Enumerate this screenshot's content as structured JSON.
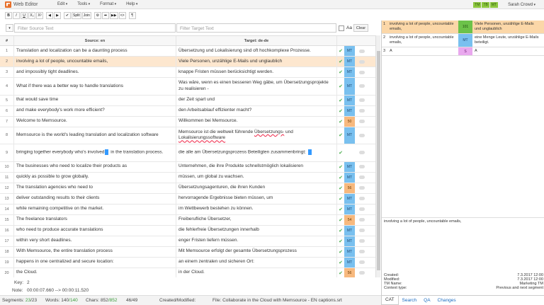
{
  "app": {
    "title": "Web Editor"
  },
  "menu": [
    "Edit",
    "Tools",
    "Format",
    "Help"
  ],
  "langs": [
    "TM",
    "TB",
    "MT"
  ],
  "user": "Sarah Crowd",
  "toolbar": {
    "bold": "B",
    "italic": "I",
    "underline": "U",
    "subscript": "X₂",
    "superscript": "X²",
    "undo": "◀",
    "redo": "▶",
    "confirm": "✔",
    "split": "Split",
    "join": "Join",
    "gear": "⚙",
    "next": "➡",
    "prev_next": "▶▶",
    "tags": "<>",
    "special": "¶"
  },
  "filter": {
    "source_placeholder": "Filter Source Text",
    "target_placeholder": "Filter Target Text",
    "case_label": "Aa",
    "clear": "Clear"
  },
  "grid": {
    "head_num": "#",
    "head_source": "Source: en",
    "head_target": "Target: de-de",
    "rows": [
      {
        "n": "1",
        "src": "Translation and localization can be a daunting process",
        "tgt": "Übersetzung und Lokalisierung sind oft hochkomplexe Prozesse.",
        "check": "✔",
        "score": "MT",
        "kind": "mt"
      },
      {
        "n": "2",
        "src": "involving a lot of people, uncountable emails,",
        "tgt": "Viele Personen, unzählige E-Mails und unglaublich",
        "check": "✔",
        "score": "MT",
        "kind": "mt",
        "sel": true
      },
      {
        "n": "3",
        "src": "and impossibly tight deadlines.",
        "tgt": "knappe Fristen müssen berücksichtigt werden.",
        "check": "✔",
        "score": "MT",
        "kind": "mt"
      },
      {
        "n": "4",
        "src": "What if there was a better way to handle translations",
        "tgt": "Was wäre, wenn es einen besseren Weg gäbe, um Übersetzungsprojekte zu realisieren -",
        "check": "✔",
        "score": "MT",
        "kind": "mt",
        "tall": true
      },
      {
        "n": "5",
        "src": "that would save time",
        "tgt": "der Zeit spart und",
        "check": "✔",
        "score": "MT",
        "kind": "mt"
      },
      {
        "n": "6",
        "src": "and make everybody's work more efficient?",
        "tgt": "den Arbeitsablauf effizienter macht?",
        "check": "✔",
        "score": "MT",
        "kind": "mt"
      },
      {
        "n": "7",
        "src": "Welcome to Memsource.",
        "tgt": "Willkommen bei Memsource.",
        "check": "✔",
        "score": "50",
        "kind": "pct"
      },
      {
        "n": "8",
        "src": "Memsource is the world's leading translation and localization software",
        "tgt": "Memsource ist die weltweit führende Übersetzungs- und Lokalisierungssoftware",
        "check": "✔",
        "score": "MT",
        "kind": "mt",
        "tall": true
      },
      {
        "n": "9",
        "src": "bringing together everybody who's involved in the translation process.",
        "tgt": "die alle am Übersetzungsprozess Beteiligten zusammenbringt:",
        "check": "✔",
        "score": "",
        "kind": "none",
        "tall": true
      },
      {
        "n": "10",
        "src": "The businesses who need to localize their products as",
        "tgt": "Unternehmen, die ihre Produkte schnellstmöglich lokalisieren",
        "check": "✔",
        "score": "MT",
        "kind": "mt"
      },
      {
        "n": "11",
        "src": "quickly as possible to grow globally.",
        "tgt": "müssen, um global zu wachsen.",
        "check": "✔",
        "score": "MT",
        "kind": "mt"
      },
      {
        "n": "12",
        "src": "The translation agencies who need to",
        "tgt": "Übersetzungsagenturen, die ihren Kunden",
        "check": "✔",
        "score": "56",
        "kind": "pct"
      },
      {
        "n": "13",
        "src": "deliver outstanding results to their clients",
        "tgt": "hervorragende Ergebnisse bieten müssen, um",
        "check": "✔",
        "score": "MT",
        "kind": "mt"
      },
      {
        "n": "14",
        "src": "while remaining competitive on the market.",
        "tgt": "im Wettbewerb bestehen zu können.",
        "check": "✔",
        "score": "MT",
        "kind": "mt"
      },
      {
        "n": "15",
        "src": "The freelance translators",
        "tgt": "Freiberufliche Übersetzer,",
        "check": "✔",
        "score": "54",
        "kind": "pct"
      },
      {
        "n": "16",
        "src": "who need to produce accurate translations",
        "tgt": "die fehlerfreie Übersetzungen innerhalb",
        "check": "✔",
        "score": "MT",
        "kind": "mt"
      },
      {
        "n": "17",
        "src": "within very short deadlines.",
        "tgt": "enger Fristen liefern müssen.",
        "check": "✔",
        "score": "MT",
        "kind": "mt"
      },
      {
        "n": "18",
        "src": "With Memsource, the entire translation process",
        "tgt": "Mit Memsource erfolgt der gesamte Übersetzungsprozess",
        "check": "✔",
        "score": "MT",
        "kind": "mt"
      },
      {
        "n": "19",
        "src": "happens in one centralized and secure location:",
        "tgt": "an einem zentralen und sicheren Ort:",
        "check": "✔",
        "score": "MT",
        "kind": "mt"
      },
      {
        "n": "20",
        "src": "the Cloud.",
        "tgt": "in der Cloud.",
        "check": "✔",
        "score": "56",
        "kind": "pct"
      }
    ]
  },
  "footer": {
    "key_label": "Key:",
    "key_value": "2",
    "note_label": "Note:",
    "note_value": "00:00:07.660 --> 00:00:11.520",
    "segments_label": "Segments:",
    "segments_done": "23",
    "segments_total": "/23",
    "words_label": "Words:",
    "words_done": "140",
    "words_total": "/140",
    "chars_label": "Chars:",
    "chars_done": "852",
    "chars_total": "/852",
    "pos": "46/49",
    "created_modified": "Created/Modified:",
    "file": "File: Collaborate in the Cloud with Memsource - EN captions.srt"
  },
  "tm": [
    {
      "n": "1",
      "src": "involving a lot of people, uncountable emails,",
      "score": "101",
      "tgt": "Viele Personen, unzählige E-Mails und unglaublich",
      "kind": "s101",
      "sel": true
    },
    {
      "n": "2",
      "src": "involving a lot of people, uncountable emails,",
      "score": "MT",
      "tgt": "eine Menge Leute, unzählige E-Mails beteiligt.",
      "kind": "smt"
    },
    {
      "n": "3",
      "src": "A",
      "score": "S",
      "tgt": "A",
      "kind": "ss"
    }
  ],
  "context_text": "involving a lot of people, uncountable emails,",
  "meta": [
    {
      "k": "Created:",
      "v": "7.3.2017 12:00"
    },
    {
      "k": "Modified:",
      "v": "7.3.2017 12:00"
    },
    {
      "k": "TM Name:",
      "v": "Marketing TM"
    },
    {
      "k": "Context type:",
      "v": "Previous and next segment"
    }
  ],
  "tabs": [
    "CAT",
    "Search",
    "QA",
    "Changes"
  ]
}
